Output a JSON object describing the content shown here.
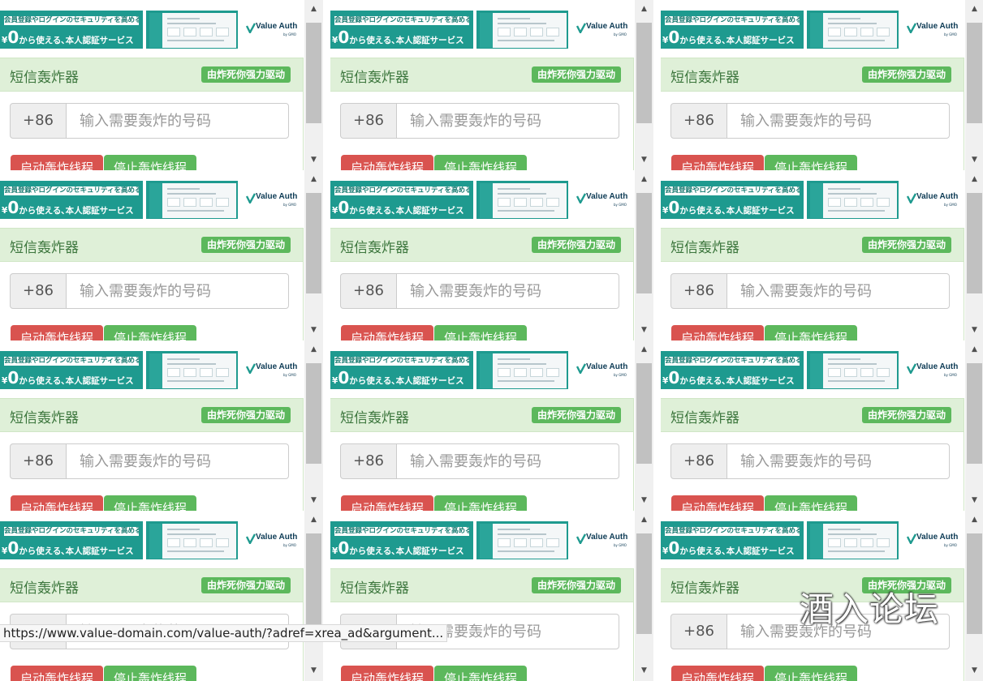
{
  "ad": {
    "headline": "会員登録やログインのセキュリティを高める",
    "price_symbol": "¥",
    "price_value": "0",
    "price_rest": "から使える､本人認証サービス",
    "logo": "Value Auth",
    "logo_sub": "by GMO",
    "brand_color": "#1e9a8f"
  },
  "panel": {
    "title": "短信轰炸器",
    "badge": "由炸死你强力驱动",
    "prefix": "+86",
    "input_placeholder": "输入需要轰炸的号码",
    "start_button": "启动轰炸线程",
    "stop_button": "停止轰炸线程",
    "header_color": "#dff0d8",
    "badge_color": "#5cb85c",
    "start_color": "#d9534f",
    "stop_color": "#5cb85c"
  },
  "frames": [
    {
      "id": "frame-1"
    },
    {
      "id": "frame-2"
    },
    {
      "id": "frame-3"
    },
    {
      "id": "frame-4"
    },
    {
      "id": "frame-5"
    },
    {
      "id": "frame-6"
    },
    {
      "id": "frame-7"
    },
    {
      "id": "frame-8"
    },
    {
      "id": "frame-9"
    },
    {
      "id": "frame-10"
    },
    {
      "id": "frame-11"
    },
    {
      "id": "frame-12"
    }
  ],
  "scrollbar": {
    "up_icon": "arrow-up-icon",
    "down_icon": "arrow-down-icon"
  },
  "status_bar": {
    "url": "https://www.value-domain.com/value-auth/?adref=xrea_ad&argument..."
  },
  "watermark": "酒入论坛"
}
